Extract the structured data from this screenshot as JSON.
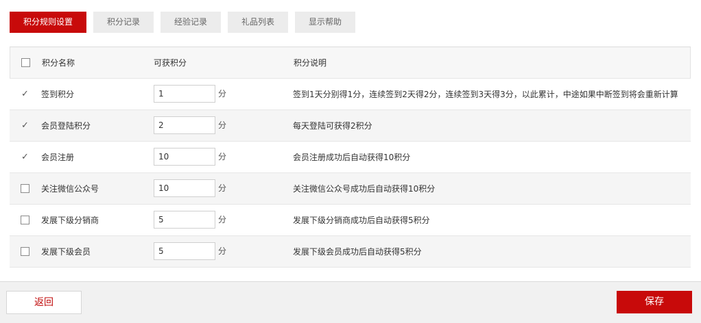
{
  "tabs": [
    {
      "label": "积分规则设置",
      "active": true
    },
    {
      "label": "积分记录",
      "active": false
    },
    {
      "label": "经验记录",
      "active": false
    },
    {
      "label": "礼品列表",
      "active": false
    },
    {
      "label": "显示帮助",
      "active": false
    }
  ],
  "table": {
    "headers": {
      "name": "积分名称",
      "points": "可获积分",
      "description": "积分说明"
    },
    "unit": "分",
    "rows": [
      {
        "checked": true,
        "name": "签到积分",
        "points": "1",
        "description": "签到1天分别得1分，连续签到2天得2分，连续签到3天得3分，以此累计，中途如果中断签到将会重新计算"
      },
      {
        "checked": true,
        "name": "会员登陆积分",
        "points": "2",
        "description": "每天登陆可获得2积分"
      },
      {
        "checked": true,
        "name": "会员注册",
        "points": "10",
        "description": "会员注册成功后自动获得10积分"
      },
      {
        "checked": false,
        "name": "关注微信公众号",
        "points": "10",
        "description": "关注微信公众号成功后自动获得10积分"
      },
      {
        "checked": false,
        "name": "发展下级分销商",
        "points": "5",
        "description": "发展下级分销商成功后自动获得5积分"
      },
      {
        "checked": false,
        "name": "发展下级会员",
        "points": "5",
        "description": "发展下级会员成功后自动获得5积分"
      }
    ]
  },
  "footer": {
    "back_label": "返回",
    "save_label": "保存"
  },
  "colors": {
    "accent": "#c80a0a",
    "tab_inactive_bg": "#ececec",
    "footer_bg": "#f1f1f1"
  }
}
